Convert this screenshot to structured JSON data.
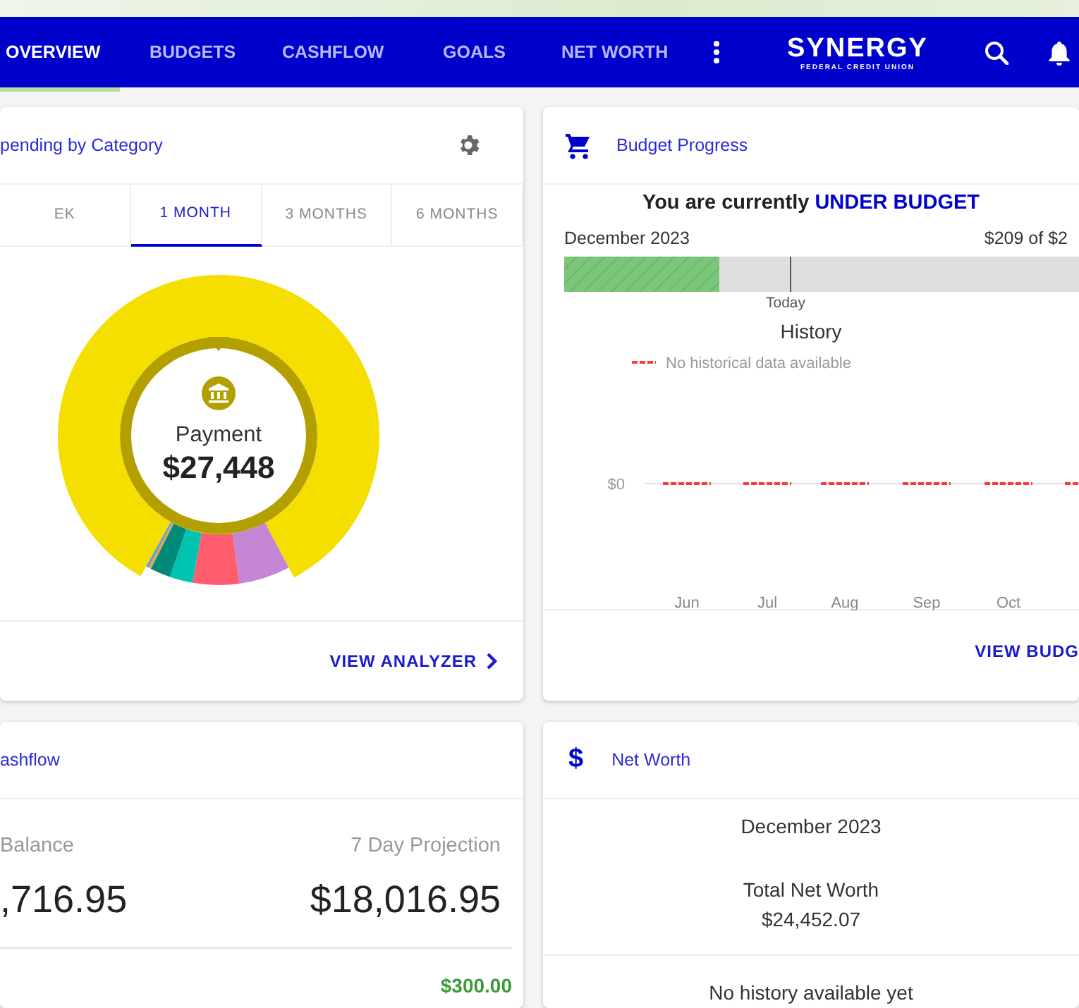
{
  "nav": {
    "items": [
      {
        "label": "OVERVIEW",
        "selected": true
      },
      {
        "label": "BUDGETS",
        "selected": false
      },
      {
        "label": "CASHFLOW",
        "selected": false
      },
      {
        "label": "GOALS",
        "selected": false
      },
      {
        "label": "NET WORTH",
        "selected": false
      }
    ],
    "logo": {
      "name": "SYNERGY",
      "tagline": "FEDERAL CREDIT UNION"
    }
  },
  "spending": {
    "title": "pending by Category",
    "tabs": [
      {
        "label": "EK",
        "selected": false
      },
      {
        "label": "1 MONTH",
        "selected": true
      },
      {
        "label": "3 MONTHS",
        "selected": false
      },
      {
        "label": "6 MONTHS",
        "selected": false
      }
    ],
    "center": {
      "label": "Payment",
      "amount": "$27,448"
    },
    "link": "VIEW ANALYZER"
  },
  "budget": {
    "title": "Budget Progress",
    "status_text": "You are currently",
    "status_value": "UNDER BUDGET",
    "month": "December 2023",
    "amount": "$209 of $2",
    "level": 0.3,
    "marker_label": "Today",
    "history": {
      "title": "History",
      "legend": "No historical data available",
      "months": [
        "Jun",
        "Jul",
        "Aug",
        "Sep",
        "Oct"
      ]
    },
    "zero_label": "$0",
    "link": "VIEW BUDG"
  },
  "cashflow": {
    "title": "ashflow",
    "columns": [
      {
        "label": "Balance",
        "amount": ",716.95"
      },
      {
        "label": "7 Day Projection",
        "amount": "$18,016.95"
      }
    ],
    "footer_amount": "$300.00"
  },
  "net_worth": {
    "icon": "$",
    "title": "Net Worth",
    "month": "December 2023",
    "total_label": "Total Net Worth",
    "total_amount": "$24,452.07",
    "history_note": "No history available yet"
  }
}
